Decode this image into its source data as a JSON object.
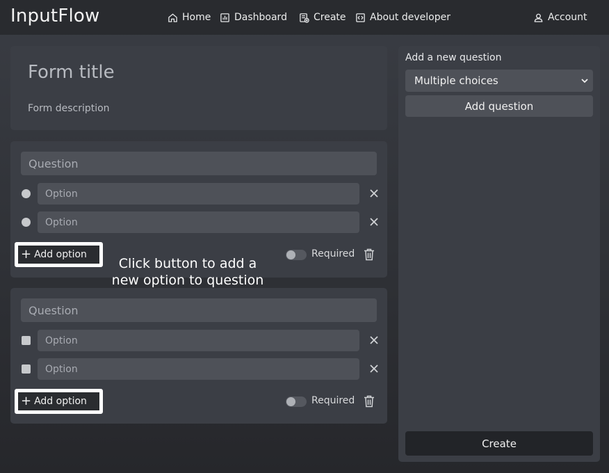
{
  "navbar": {
    "brand": "InputFlow",
    "links": [
      {
        "label": "Home",
        "icon": "home-icon"
      },
      {
        "label": "Dashboard",
        "icon": "dashboard-icon"
      },
      {
        "label": "Create",
        "icon": "create-icon"
      },
      {
        "label": "About developer",
        "icon": "code-icon"
      }
    ],
    "account": {
      "label": "Account",
      "icon": "user-icon"
    }
  },
  "form": {
    "title_placeholder": "Form title",
    "description_placeholder": "Form description"
  },
  "questions": [
    {
      "type": "radio",
      "question_placeholder": "Question",
      "options": [
        "Option",
        "Option"
      ],
      "add_option_label": "Add option",
      "required_label": "Required",
      "required": false
    },
    {
      "type": "checkbox",
      "question_placeholder": "Question",
      "options": [
        "Option",
        "Option"
      ],
      "add_option_label": "Add option",
      "required_label": "Required",
      "required": false
    }
  ],
  "annotation": {
    "line1": "Click button to add a",
    "line2": "new option to question"
  },
  "sidebar": {
    "title": "Add a new question",
    "question_type_selected": "Multiple choices",
    "add_question_label": "Add question",
    "create_label": "Create"
  },
  "colors": {
    "background": "#2e3035",
    "navbar": "#292b2f",
    "card": "#3b3e45",
    "field": "#4e5158",
    "highlight_border": "#ffffff"
  }
}
